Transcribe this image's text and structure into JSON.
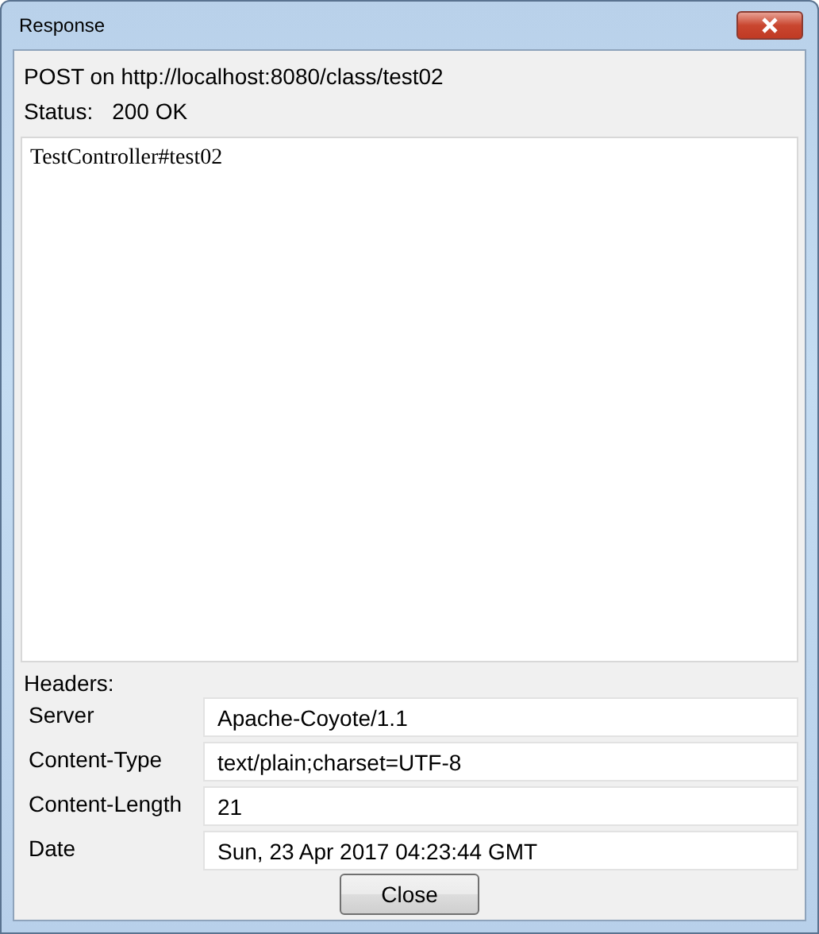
{
  "window": {
    "title": "Response"
  },
  "request_line": "POST on http://localhost:8080/class/test02",
  "status": {
    "label": "Status:",
    "value": "200 OK"
  },
  "body": "TestController#test02",
  "headers_label": "Headers:",
  "headers": [
    {
      "name": "Server",
      "value": "Apache-Coyote/1.1"
    },
    {
      "name": "Content-Type",
      "value": "text/plain;charset=UTF-8"
    },
    {
      "name": "Content-Length",
      "value": "21"
    },
    {
      "name": "Date",
      "value": "Sun, 23 Apr 2017 04:23:44 GMT"
    }
  ],
  "buttons": [
    "Close"
  ]
}
